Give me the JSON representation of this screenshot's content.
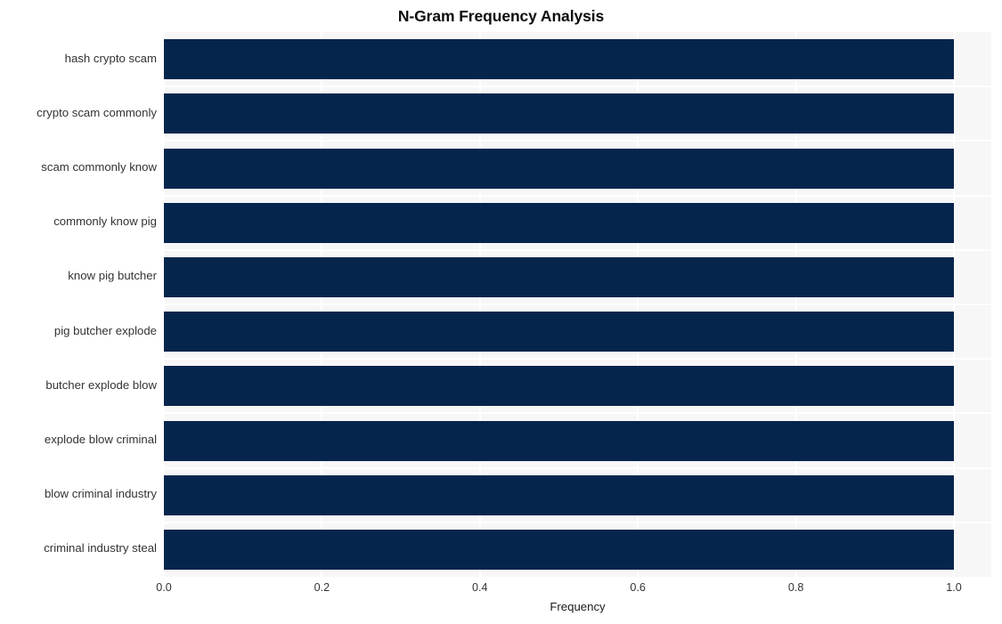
{
  "chart_data": {
    "type": "bar",
    "orientation": "horizontal",
    "title": "N-Gram Frequency Analysis",
    "xlabel": "Frequency",
    "ylabel": "",
    "categories": [
      "hash crypto scam",
      "crypto scam commonly",
      "scam commonly know",
      "commonly know pig",
      "know pig butcher",
      "pig butcher explode",
      "butcher explode blow",
      "explode blow criminal",
      "blow criminal industry",
      "criminal industry steal"
    ],
    "values": [
      1.0,
      1.0,
      1.0,
      1.0,
      1.0,
      1.0,
      1.0,
      1.0,
      1.0,
      1.0
    ],
    "xlim": [
      0.0,
      1.0
    ],
    "xticks": [
      "0.0",
      "0.2",
      "0.4",
      "0.6",
      "0.8",
      "1.0"
    ],
    "xtick_values": [
      0.0,
      0.2,
      0.4,
      0.6,
      0.8,
      1.0
    ],
    "grid": true,
    "grid_color": "#ffffff",
    "legend": null,
    "bar_color": "#06254d",
    "plot_background": "#f7f7f7",
    "figure_background": "#ffffff",
    "tick_label_color": "#333333",
    "title_color": "#0d0d0d"
  }
}
